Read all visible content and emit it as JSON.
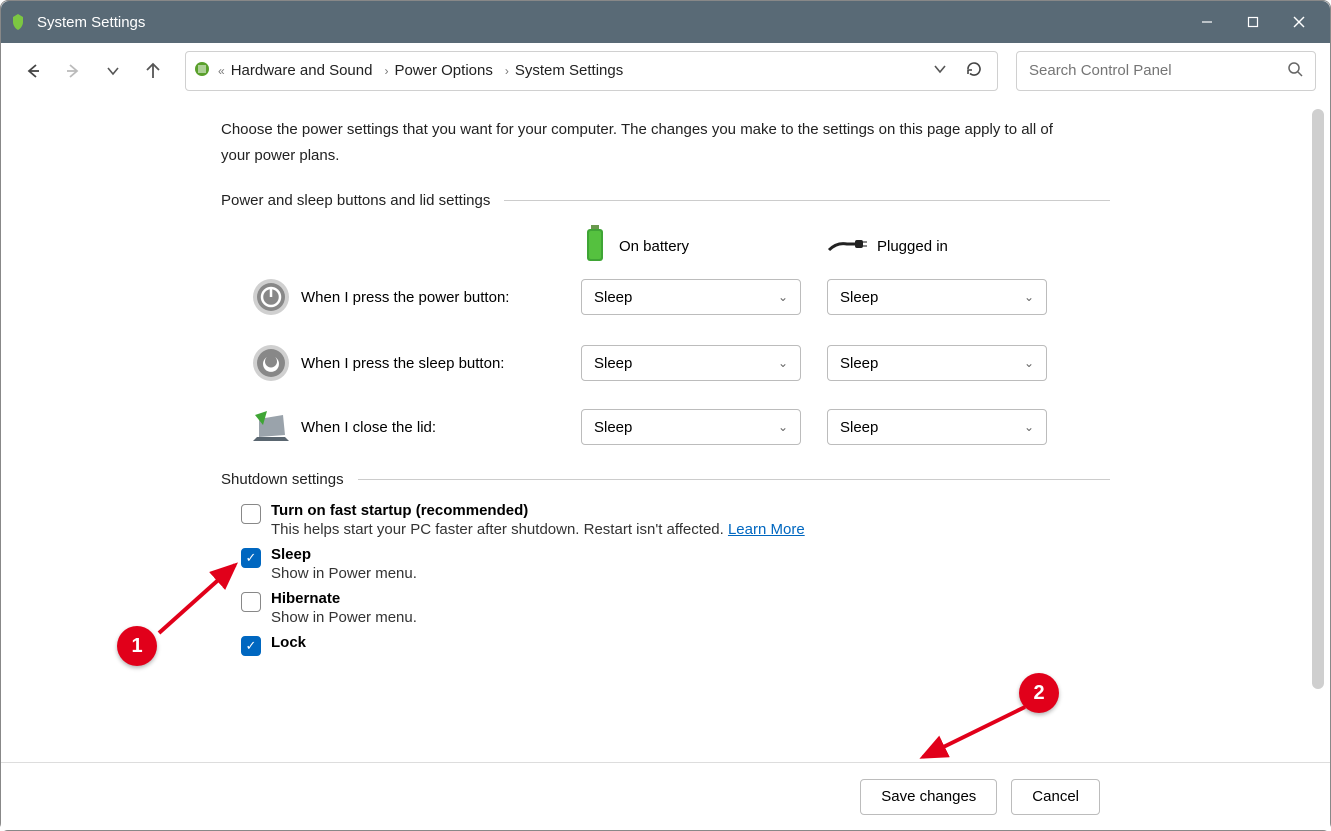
{
  "window": {
    "title": "System Settings"
  },
  "breadcrumb": {
    "items": [
      "Hardware and Sound",
      "Power Options",
      "System Settings"
    ]
  },
  "search": {
    "placeholder": "Search Control Panel"
  },
  "intro": "Choose the power settings that you want for your computer. The changes you make to the settings on this page apply to all of your power plans.",
  "section1_title": "Power and sleep buttons and lid settings",
  "col_headers": {
    "battery": "On battery",
    "plugged": "Plugged in"
  },
  "rows": [
    {
      "label": "When I press the power button:",
      "battery": "Sleep",
      "plugged": "Sleep"
    },
    {
      "label": "When I press the sleep button:",
      "battery": "Sleep",
      "plugged": "Sleep"
    },
    {
      "label": "When I close the lid:",
      "battery": "Sleep",
      "plugged": "Sleep"
    }
  ],
  "section2_title": "Shutdown settings",
  "shutdown": [
    {
      "checked": false,
      "title": "Turn on fast startup (recommended)",
      "sub": "This helps start your PC faster after shutdown. Restart isn't affected.",
      "link": "Learn More"
    },
    {
      "checked": true,
      "title": "Sleep",
      "sub": "Show in Power menu."
    },
    {
      "checked": false,
      "title": "Hibernate",
      "sub": "Show in Power menu."
    },
    {
      "checked": true,
      "title": "Lock",
      "sub": ""
    }
  ],
  "footer": {
    "save": "Save changes",
    "cancel": "Cancel"
  },
  "annotations": {
    "one": "1",
    "two": "2"
  }
}
